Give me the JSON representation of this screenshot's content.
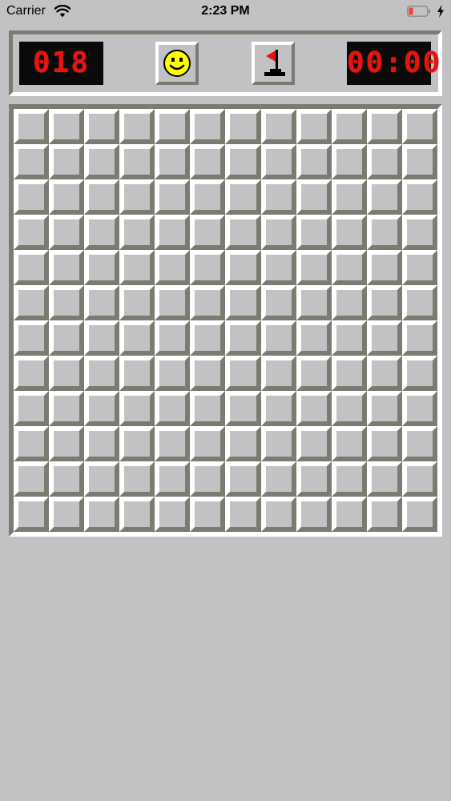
{
  "status_bar": {
    "carrier": "Carrier",
    "time": "2:23 PM",
    "icons": [
      "wifi-icon",
      "battery-low-icon",
      "charging-bolt-icon"
    ]
  },
  "game": {
    "mines_remaining": "018",
    "timer": "00:00",
    "smiley_icon": "smiley-face-icon",
    "flag_icon": "flag-icon"
  },
  "board": {
    "rows": 12,
    "columns": 12,
    "cell_state": "unrevealed"
  },
  "colors": {
    "background": "#c2c1c4",
    "highlight": "#ffffff",
    "shadow": "#7b7b72",
    "lcd_background": "#0a0a0a",
    "lcd_digits": "#e8120e",
    "smiley_face": "#ffff00",
    "flag": "#e81010"
  }
}
